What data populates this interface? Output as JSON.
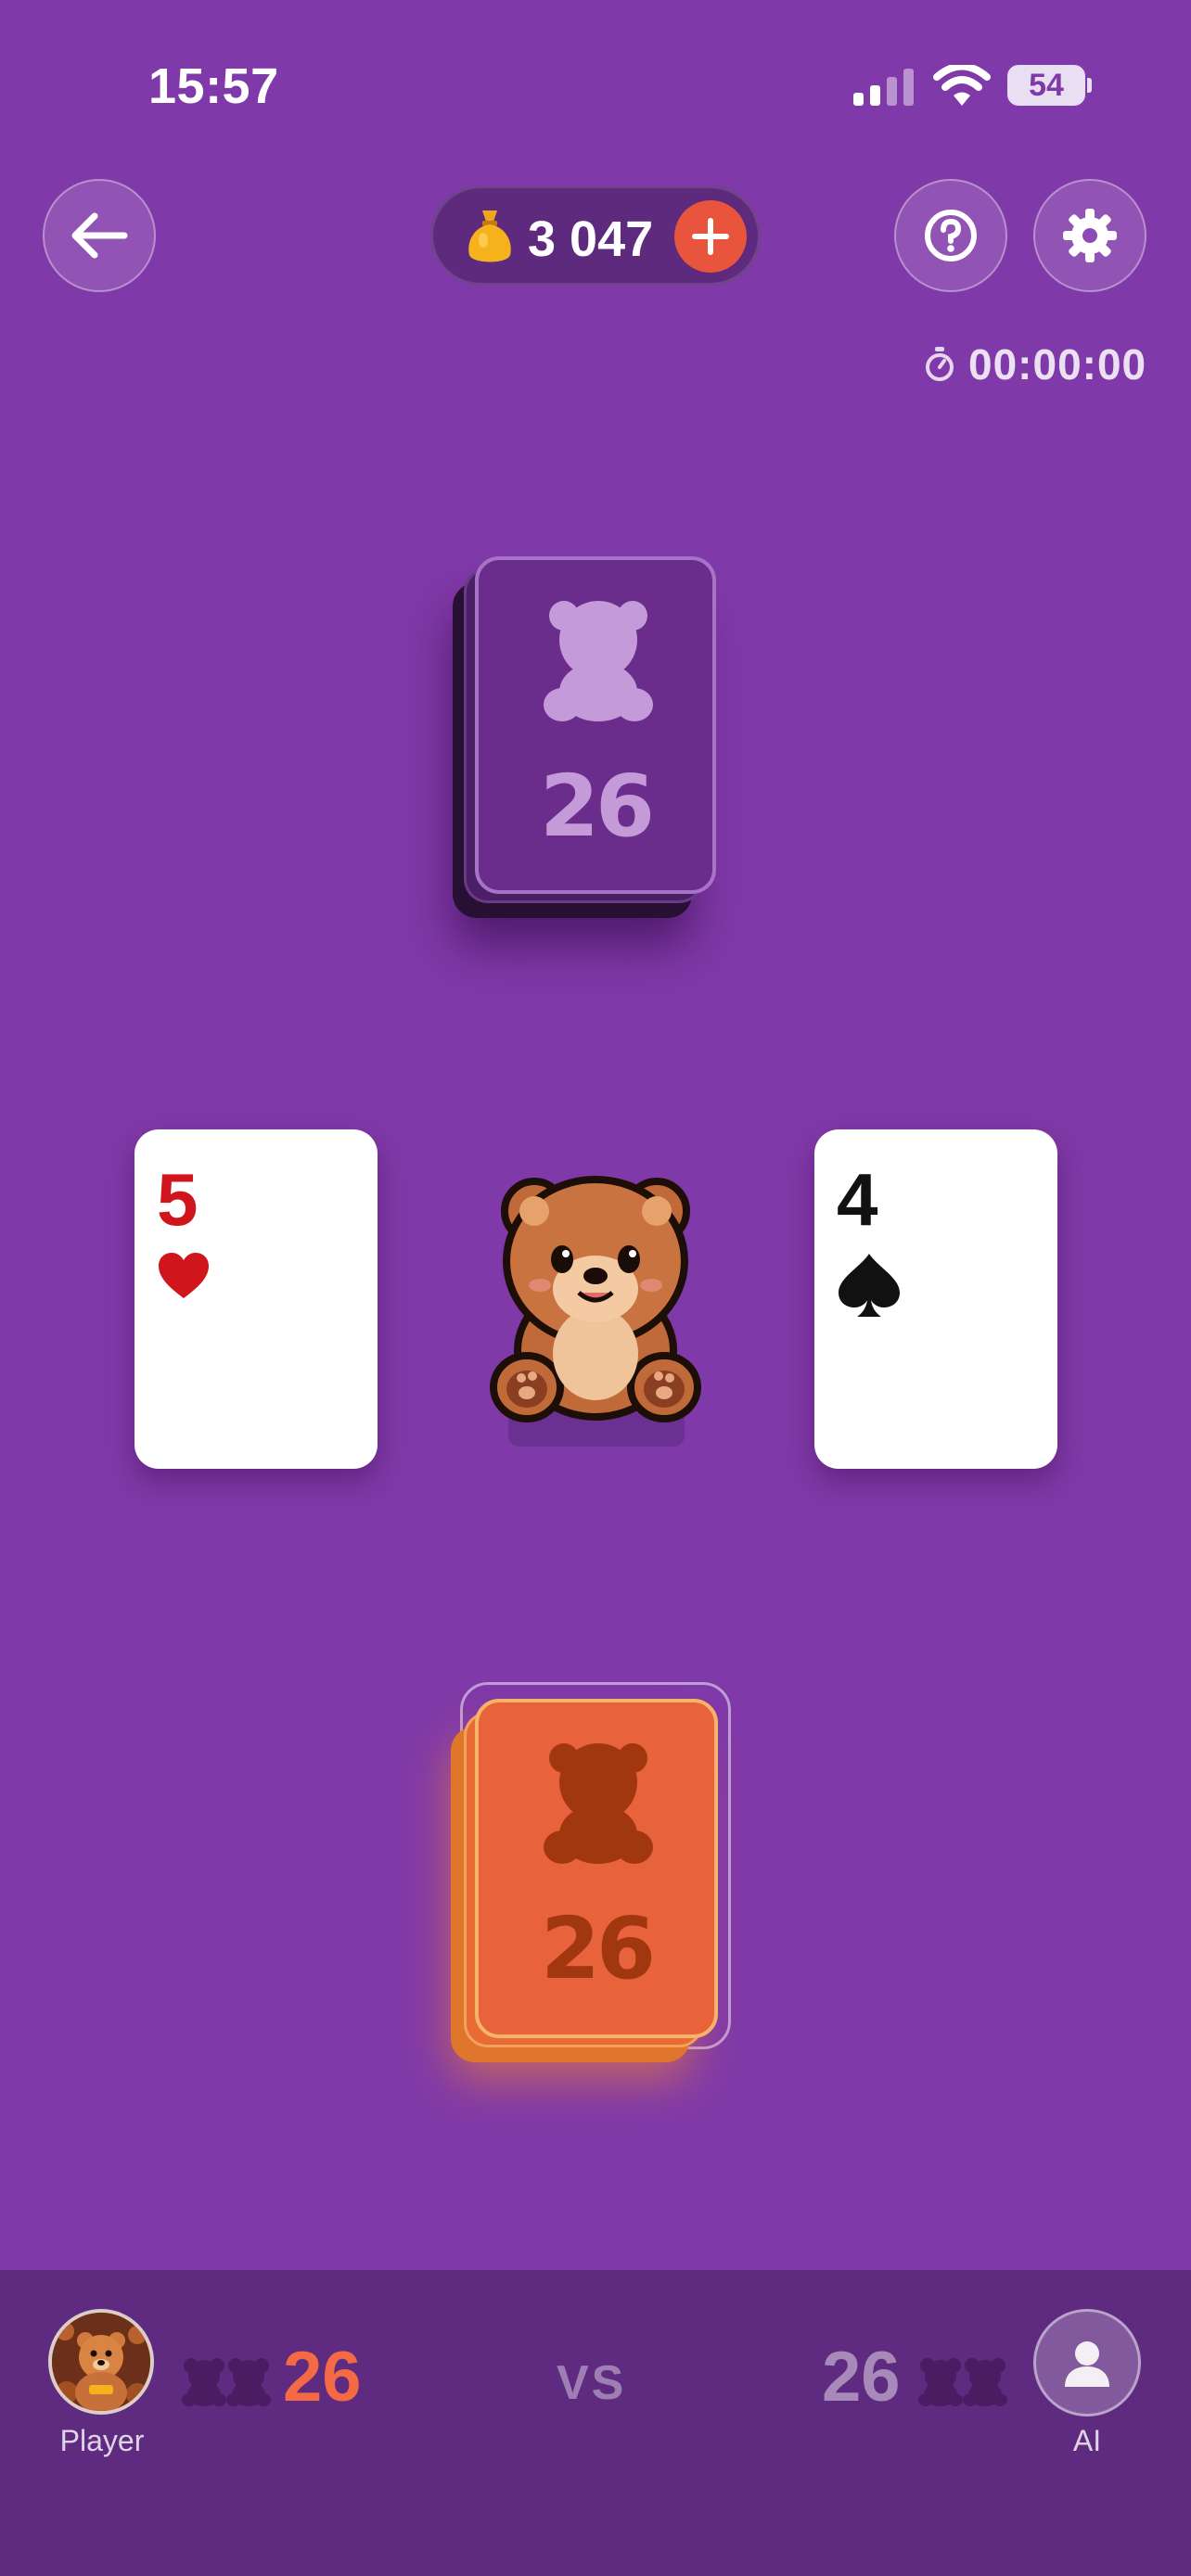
{
  "status_bar": {
    "time": "15:57",
    "battery": "54"
  },
  "top_bar": {
    "coins": "3 047",
    "timer": "00:00:00"
  },
  "ai_deck": {
    "count": "26"
  },
  "player_deck": {
    "count": "26"
  },
  "played_cards": {
    "left": {
      "rank": "5",
      "suit": "heart",
      "color": "#d0161c"
    },
    "right": {
      "rank": "4",
      "suit": "spade",
      "color": "#111111"
    }
  },
  "scoreboard": {
    "player_name": "Player",
    "player_score": "26",
    "vs": "VS",
    "ai_name": "AI",
    "ai_score": "26"
  },
  "colors": {
    "background": "#8039a8",
    "accent": "#e8543c",
    "player_score": "#f46a45"
  },
  "icons": [
    "back-arrow-icon",
    "coin-bag-icon",
    "plus-icon",
    "help-icon",
    "gear-icon",
    "stopwatch-icon",
    "bear-icon",
    "heart-suit-icon",
    "spade-suit-icon",
    "user-icon"
  ]
}
